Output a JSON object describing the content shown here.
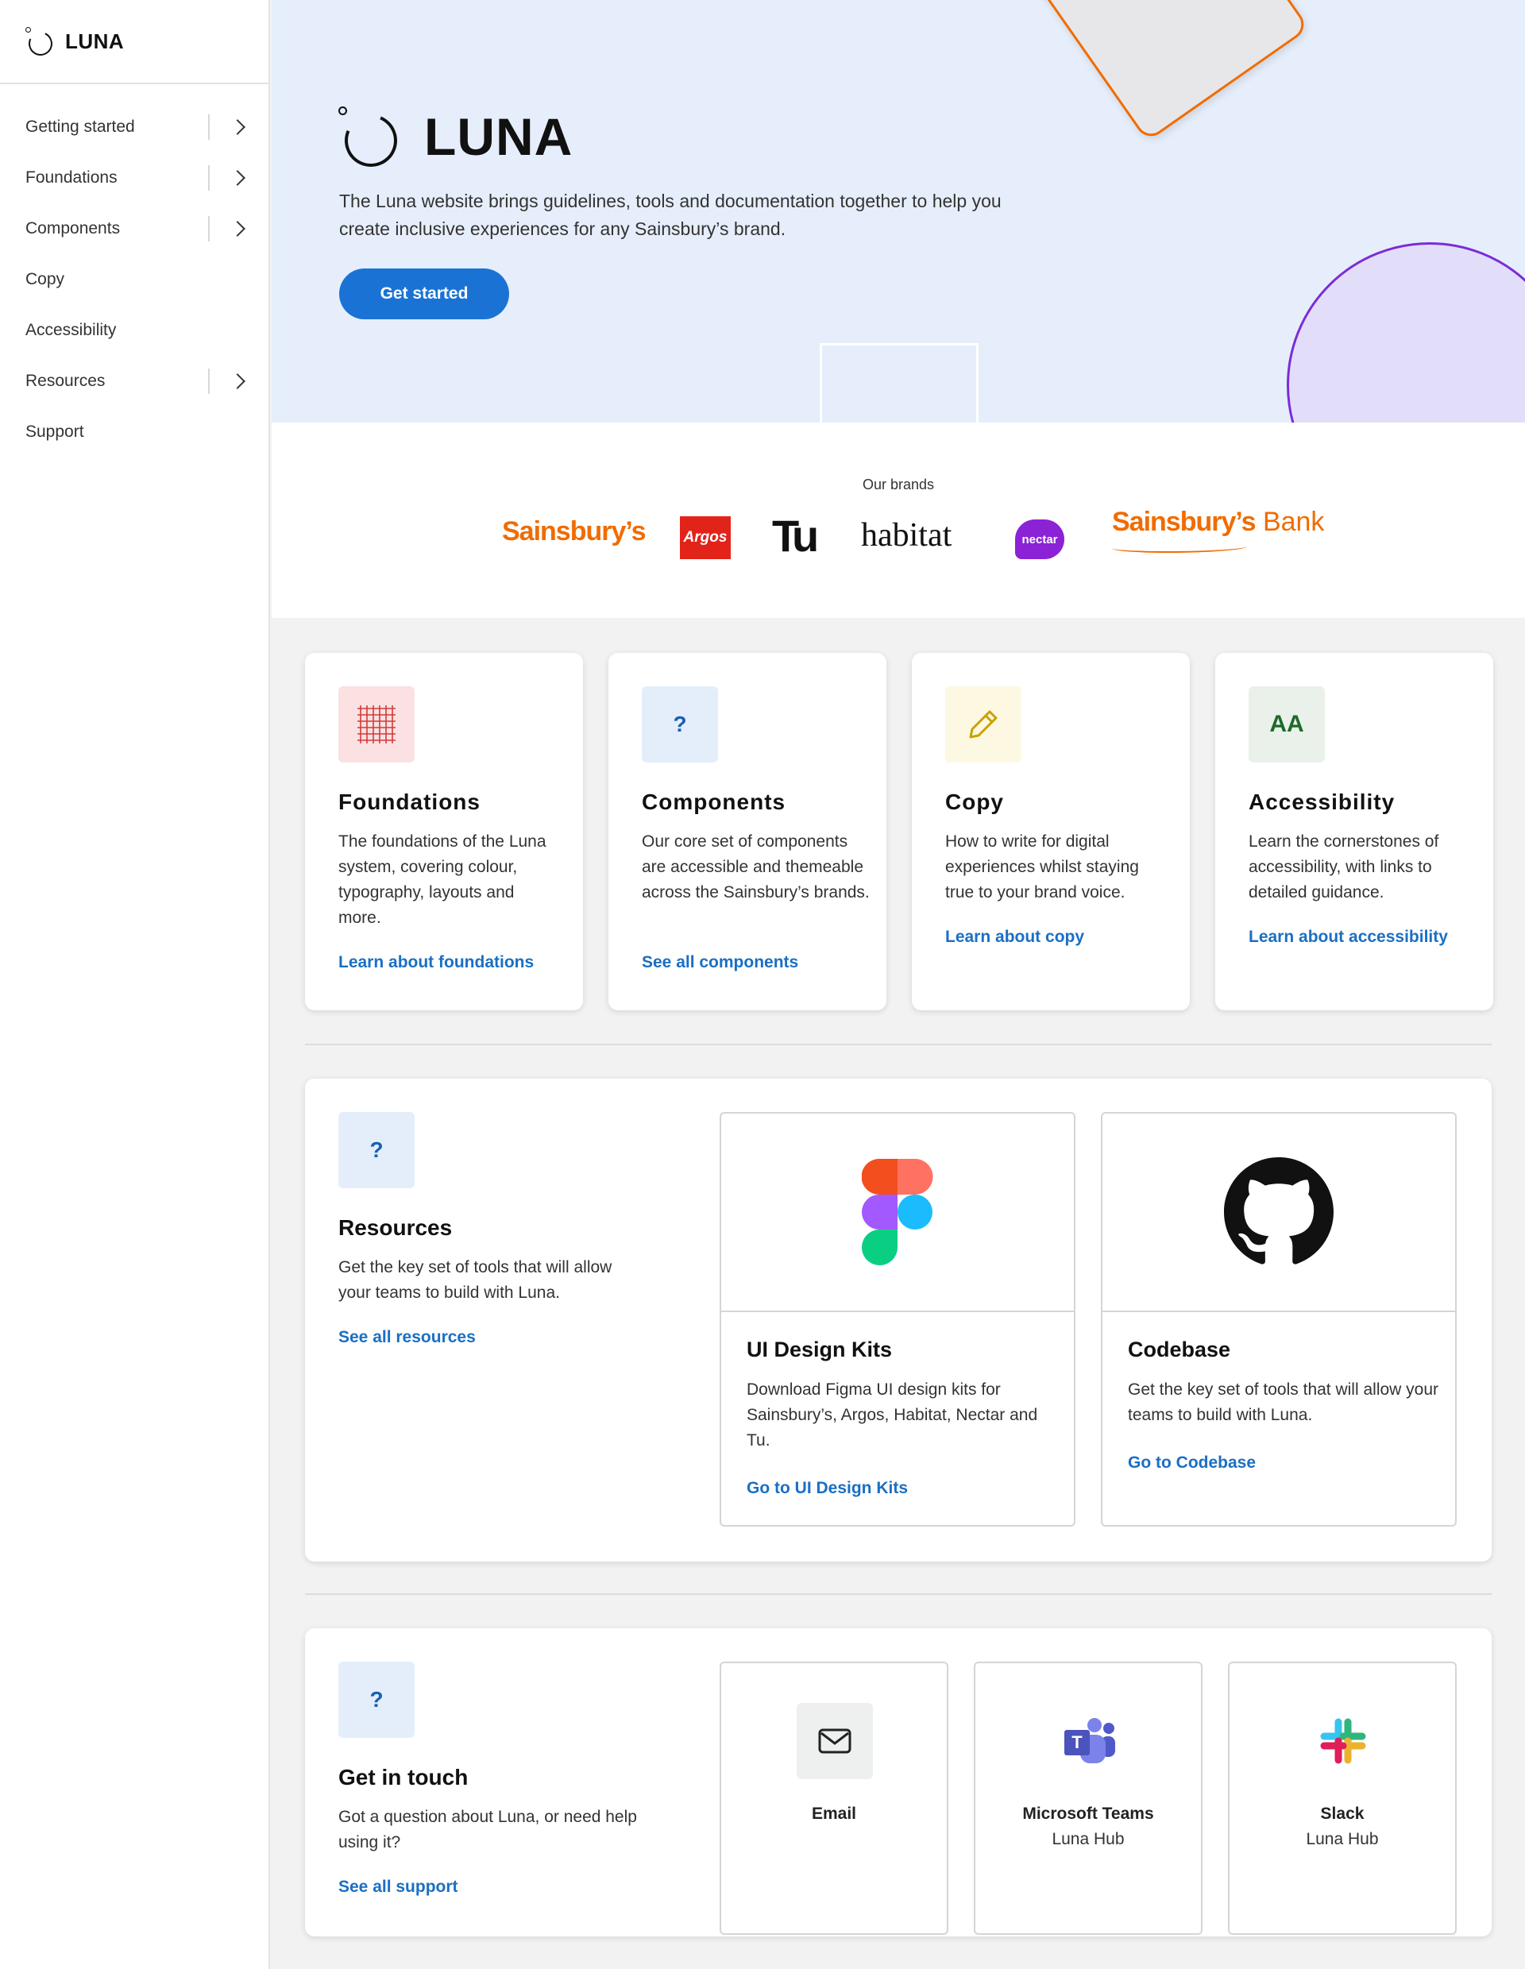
{
  "sidebar": {
    "brand": "LUNA",
    "items": [
      {
        "label": "Getting started",
        "has_children": true
      },
      {
        "label": "Foundations",
        "has_children": true
      },
      {
        "label": "Components",
        "has_children": true
      },
      {
        "label": "Copy",
        "has_children": false
      },
      {
        "label": "Accessibility",
        "has_children": false
      },
      {
        "label": "Resources",
        "has_children": true
      },
      {
        "label": "Support",
        "has_children": false
      }
    ]
  },
  "hero": {
    "title": "LUNA",
    "description": "The Luna website brings guidelines, tools and documentation together to help you create inclusive experiences for any Sainsbury’s brand.",
    "button_label": "Get started",
    "accent_color": "#1a73d4"
  },
  "brands": {
    "label": "Our brands",
    "sainsburys": "Sainsbury’s",
    "argos": "Argos",
    "tu": "Tu",
    "habitat": "habitat",
    "nectar": "nectar",
    "bank_name": "Sainsbury’s",
    "bank_suffix": "Bank"
  },
  "feature_cards": [
    {
      "icon": "grid-icon",
      "title": "Foundations",
      "description": "The foundations of the Luna system, covering colour, typography, layouts and more.",
      "link": "Learn about foundations"
    },
    {
      "icon": "question-icon",
      "title": "Components",
      "description": "Our core set of components are accessible and themeable across the Sainsbury’s brands.",
      "link": "See all components"
    },
    {
      "icon": "pencil-icon",
      "title": "Copy",
      "description": "How to write for digital experiences whilst staying true to your brand voice.",
      "link": "Learn about copy"
    },
    {
      "icon": "aa-icon",
      "icon_text": "AA",
      "title": "Accessibility",
      "description": "Learn the cornerstones of accessibility, with links to detailed guidance.",
      "link": "Learn about accessibility"
    }
  ],
  "resources": {
    "icon": "question-icon",
    "title": "Resources",
    "description": "Get the key set of tools that will allow your teams to build with Luna.",
    "link": "See all resources",
    "cards": [
      {
        "icon": "figma-icon",
        "title": "UI Design Kits",
        "description": "Download Figma UI design kits for Sainsbury’s, Argos, Habitat, Nectar and Tu.",
        "link": "Go to UI Design Kits"
      },
      {
        "icon": "github-icon",
        "title": "Codebase",
        "description": "Get the key set of tools that will allow your teams to build with Luna.",
        "link": "Go to Codebase"
      }
    ]
  },
  "contact": {
    "icon": "question-icon",
    "title": "Get in touch",
    "description": "Got a question about Luna, or need help using it?",
    "link": "See all support",
    "cards": [
      {
        "icon": "mail-icon",
        "title": "Email",
        "subtitle": ""
      },
      {
        "icon": "teams-icon",
        "title": "Microsoft Teams",
        "subtitle": "Luna Hub"
      },
      {
        "icon": "slack-icon",
        "title": "Slack",
        "subtitle": "Luna Hub"
      }
    ]
  },
  "colors": {
    "orange": "#f06c00",
    "purple": "#7b2cd8",
    "link": "#1a6fc4"
  }
}
